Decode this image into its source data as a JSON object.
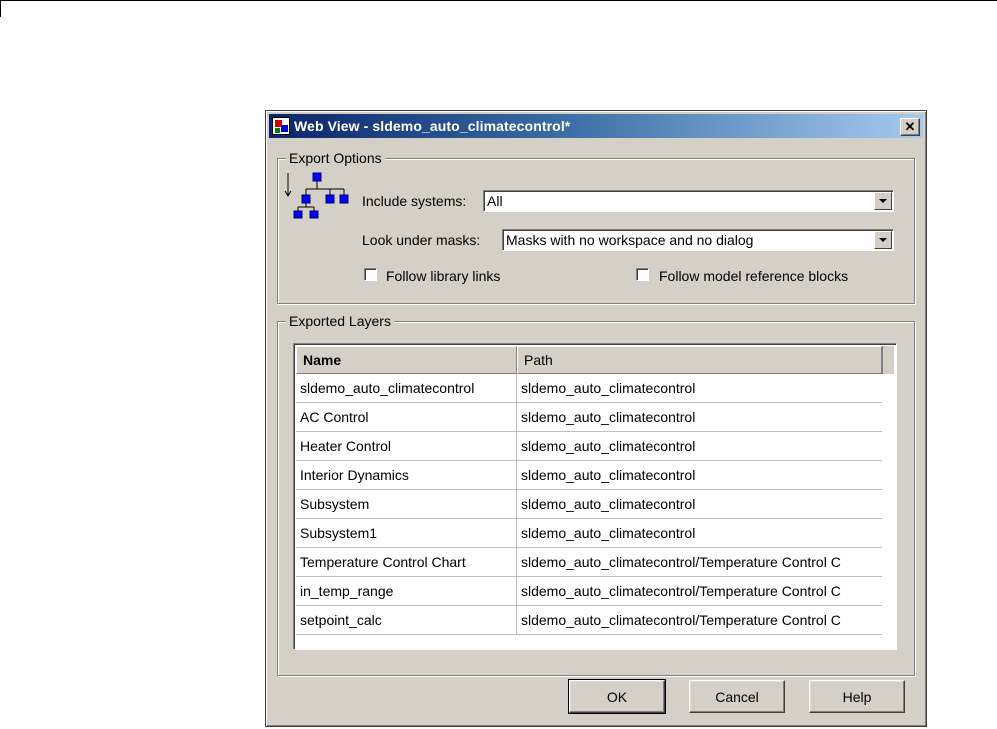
{
  "window": {
    "title": "Web View - sldemo_auto_climatecontrol*",
    "close_glyph": "✕"
  },
  "export_options": {
    "legend": "Export Options",
    "include_systems_label": "Include systems:",
    "include_systems_value": "All",
    "look_under_masks_label": "Look under masks:",
    "look_under_masks_value": "Masks with no workspace and no dialog",
    "follow_library_links_label": "Follow library links",
    "follow_library_links_checked": false,
    "follow_model_ref_label": "Follow model reference blocks",
    "follow_model_ref_checked": false
  },
  "exported_layers": {
    "legend": "Exported Layers",
    "columns": [
      "Name",
      "Path"
    ],
    "rows": [
      [
        "sldemo_auto_climatecontrol",
        "sldemo_auto_climatecontrol"
      ],
      [
        "AC Control",
        "sldemo_auto_climatecontrol"
      ],
      [
        "Heater Control",
        "sldemo_auto_climatecontrol"
      ],
      [
        "Interior Dynamics",
        "sldemo_auto_climatecontrol"
      ],
      [
        "Subsystem",
        "sldemo_auto_climatecontrol"
      ],
      [
        "Subsystem1",
        "sldemo_auto_climatecontrol"
      ],
      [
        "Temperature Control Chart",
        "sldemo_auto_climatecontrol/Temperature Control C"
      ],
      [
        "in_temp_range",
        "sldemo_auto_climatecontrol/Temperature Control C"
      ],
      [
        "setpoint_calc",
        "sldemo_auto_climatecontrol/Temperature Control C"
      ]
    ]
  },
  "buttons": {
    "ok": "OK",
    "cancel": "Cancel",
    "help": "Help"
  },
  "colors": {
    "titlebar_start": "#0a246a",
    "dialog_bg": "#d4d0c8",
    "hierarchy_box": "#0000ff"
  }
}
